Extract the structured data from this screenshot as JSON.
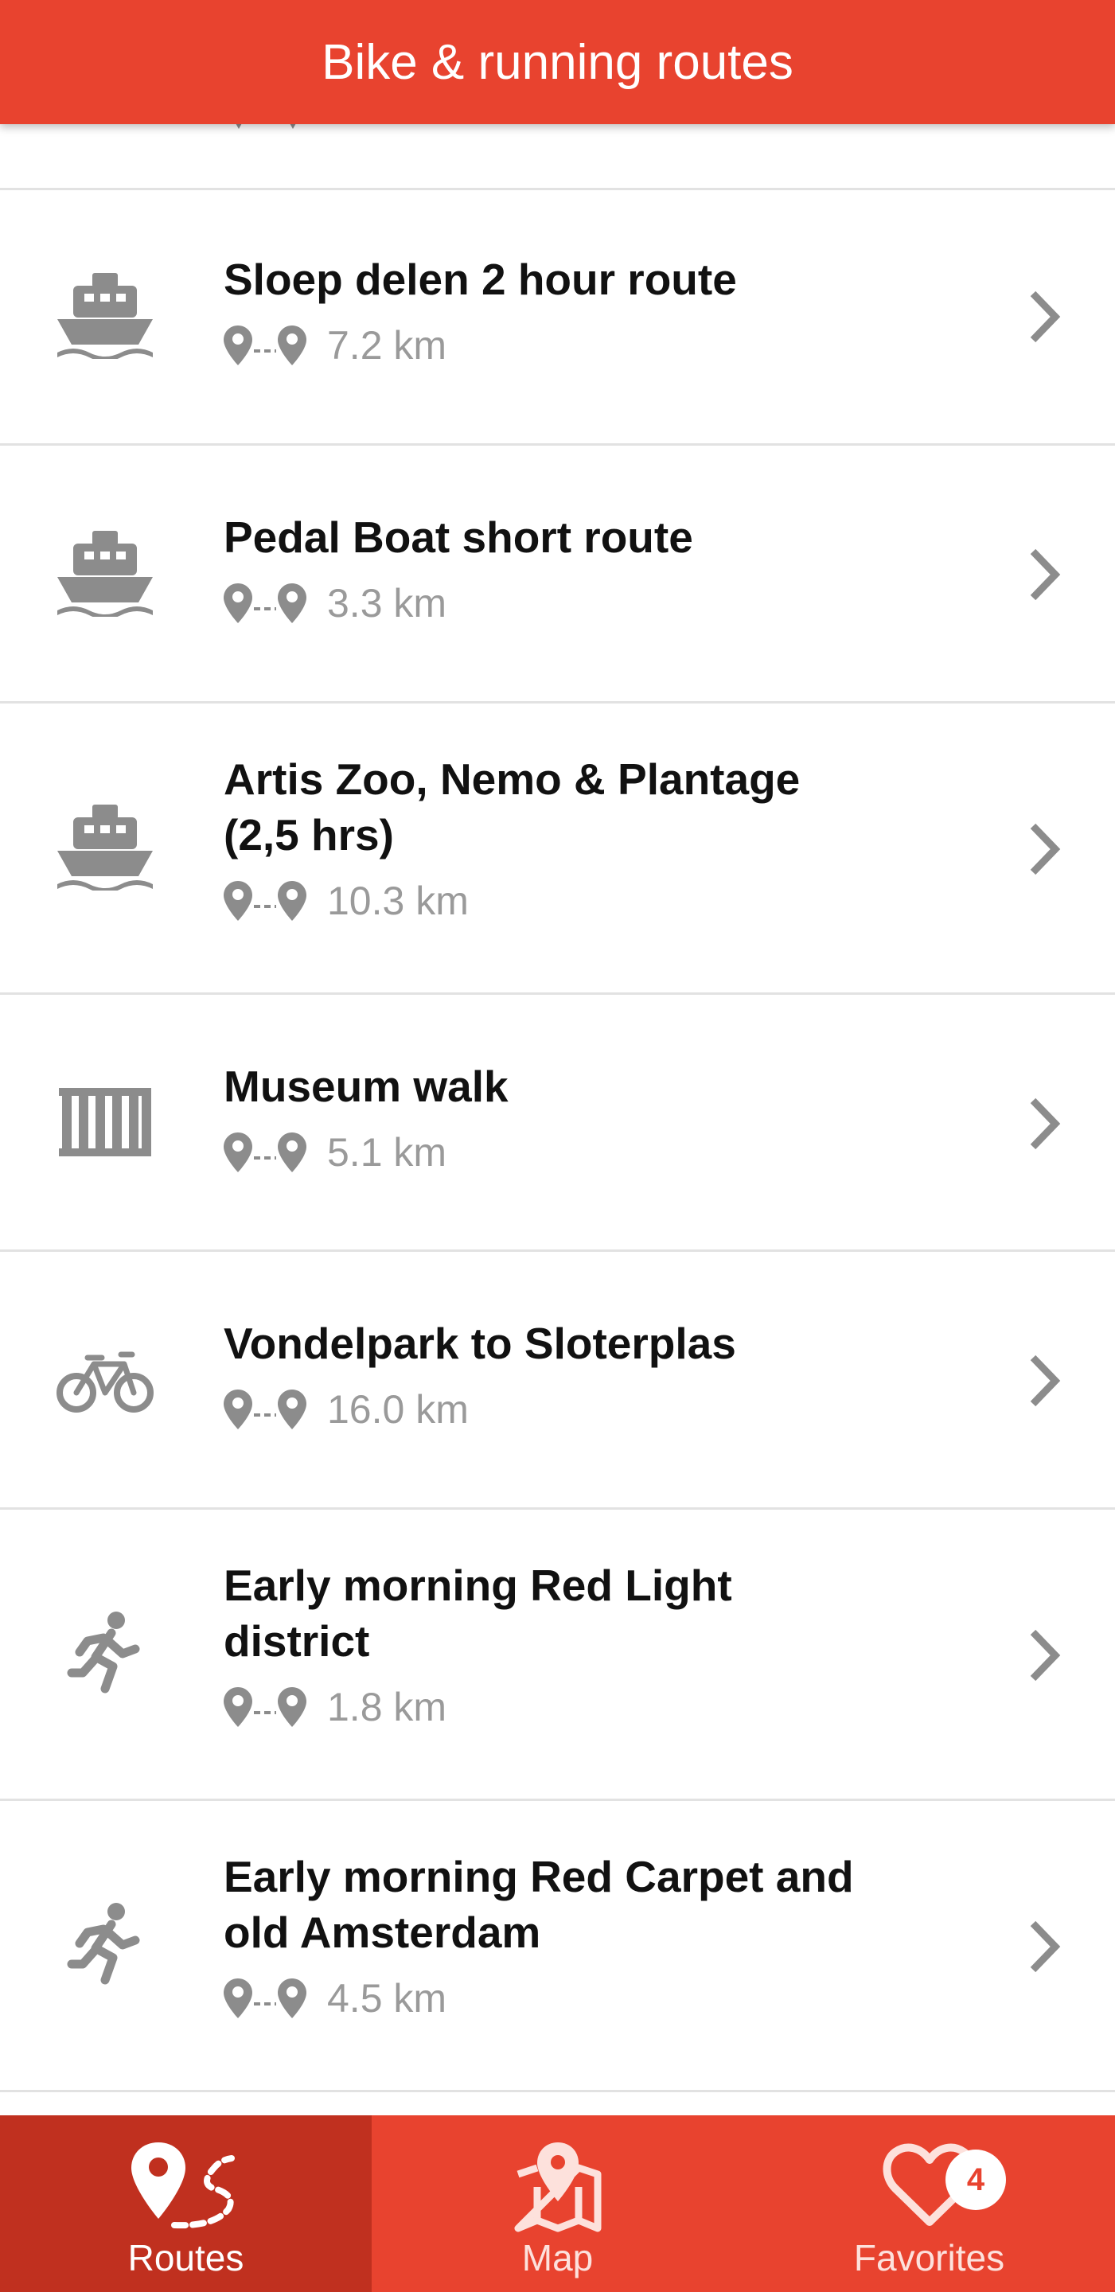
{
  "header": {
    "title": "Bike & running routes"
  },
  "routes": [
    {
      "icon": "boat-icon",
      "title": "Sloep delen 2 hour route",
      "distance": "7.2 km"
    },
    {
      "icon": "boat-icon",
      "title": "Pedal Boat short route",
      "distance": "3.3 km"
    },
    {
      "icon": "boat-icon",
      "title": "Artis Zoo, Nemo & Plantage (2,5 hrs)",
      "distance": "10.3 km"
    },
    {
      "icon": "museum-icon",
      "title": "Museum walk",
      "distance": "5.1 km"
    },
    {
      "icon": "bike-icon",
      "title": "Vondelpark to Sloterplas",
      "distance": "16.0 km"
    },
    {
      "icon": "running-icon",
      "title": "Early morning Red Light district",
      "distance": "1.8 km"
    },
    {
      "icon": "running-icon",
      "title": "Early morning Red Carpet and old Amsterdam",
      "distance": "4.5 km"
    }
  ],
  "tabs": [
    {
      "icon": "routes-icon",
      "label": "Routes",
      "active": true
    },
    {
      "icon": "map-icon",
      "label": "Map",
      "active": false
    },
    {
      "icon": "heart-icon",
      "label": "Favorites",
      "active": false
    }
  ],
  "favorites_count": "4",
  "colors": {
    "accent": "#e8432f",
    "accent_dark": "#c0301f",
    "icon_gray": "#8c8c8c",
    "meta_gray": "#9a9a9a"
  }
}
